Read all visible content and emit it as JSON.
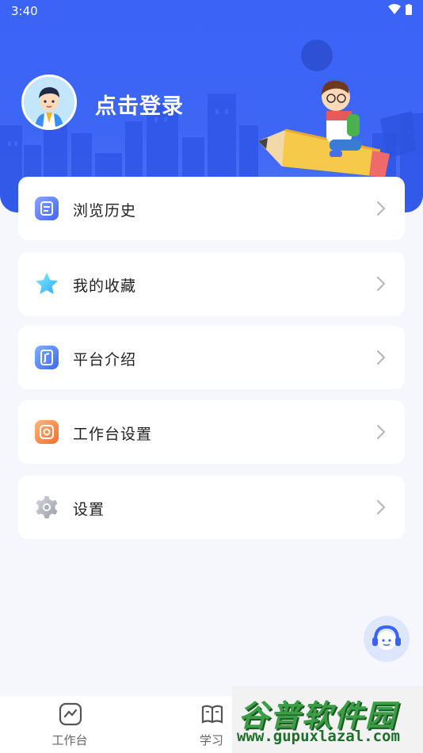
{
  "status_bar": {
    "time": "3:40"
  },
  "header": {
    "login_text": "点击登录"
  },
  "menu": [
    {
      "label": "浏览历史",
      "icon": "history-icon"
    },
    {
      "label": "我的收藏",
      "icon": "star-icon"
    },
    {
      "label": "平台介绍",
      "icon": "platform-intro-icon"
    },
    {
      "label": "工作台设置",
      "icon": "workbench-settings-icon"
    },
    {
      "label": "设置",
      "icon": "gear-icon"
    }
  ],
  "tabbar": {
    "tabs": [
      {
        "label": "工作台",
        "icon": "workbench-icon"
      },
      {
        "label": "学习",
        "icon": "book-icon"
      }
    ]
  },
  "watermark": {
    "title": "谷普软件园",
    "url": "www.gupuxlazal.com"
  },
  "colors": {
    "primary": "#3b63f6",
    "background": "#f5f7fc",
    "card": "#ffffff"
  }
}
